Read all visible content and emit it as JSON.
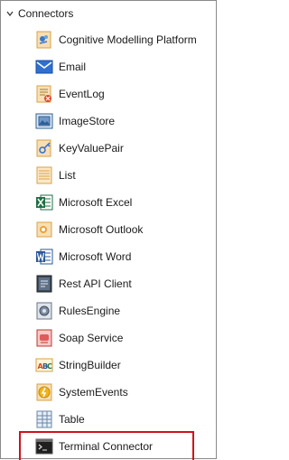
{
  "group": {
    "label": "Connectors",
    "expanded": true
  },
  "items": [
    {
      "label": "Cognitive Modelling Platform",
      "icon": "cognitive-icon"
    },
    {
      "label": "Email",
      "icon": "email-icon"
    },
    {
      "label": "EventLog",
      "icon": "eventlog-icon"
    },
    {
      "label": "ImageStore",
      "icon": "imagestore-icon"
    },
    {
      "label": "KeyValuePair",
      "icon": "keyvaluepair-icon"
    },
    {
      "label": "List",
      "icon": "list-icon"
    },
    {
      "label": "Microsoft Excel",
      "icon": "excel-icon"
    },
    {
      "label": "Microsoft Outlook",
      "icon": "outlook-icon"
    },
    {
      "label": "Microsoft Word",
      "icon": "word-icon"
    },
    {
      "label": "Rest API Client",
      "icon": "rest-api-icon"
    },
    {
      "label": "RulesEngine",
      "icon": "rulesengine-icon"
    },
    {
      "label": "Soap Service",
      "icon": "soap-icon"
    },
    {
      "label": "StringBuilder",
      "icon": "stringbuilder-icon"
    },
    {
      "label": "SystemEvents",
      "icon": "systemevents-icon"
    },
    {
      "label": "Table",
      "icon": "table-icon"
    },
    {
      "label": "Terminal Connector",
      "icon": "terminal-icon",
      "highlighted": true
    }
  ],
  "colors": {
    "highlight_border": "#d0121b",
    "panel_border": "#8a8a8a"
  }
}
